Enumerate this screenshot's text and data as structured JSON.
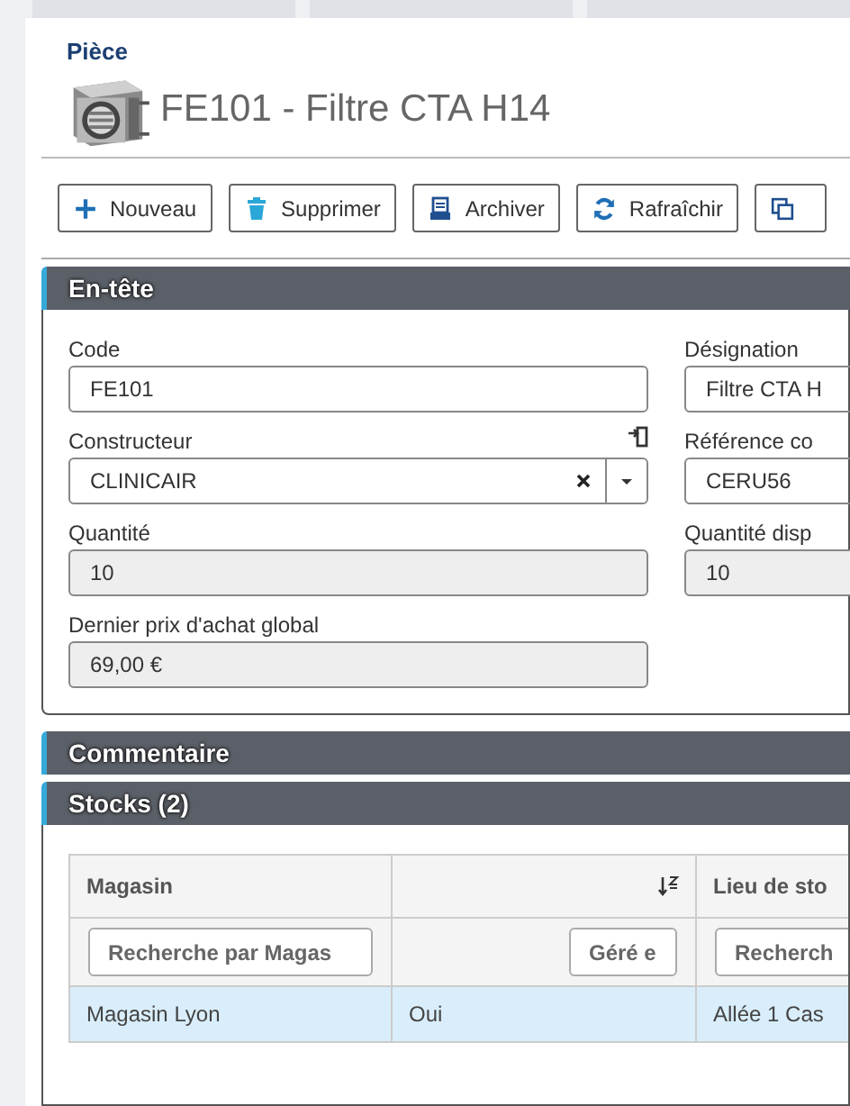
{
  "header": {
    "breadcrumb": "Pièce",
    "title": "FE101 - Filtre CTA H14"
  },
  "toolbar": [
    {
      "kind": "new",
      "label": "Nouveau"
    },
    {
      "kind": "delete",
      "label": "Supprimer"
    },
    {
      "kind": "archive",
      "label": "Archiver"
    },
    {
      "kind": "refresh",
      "label": "Rafraîchir"
    },
    {
      "kind": "copy"
    }
  ],
  "en_tete": {
    "title": "En-tête",
    "rows": [
      {
        "fields": [
          {
            "kind": "text",
            "label": "Code",
            "value": "FE101"
          },
          {
            "kind": "text",
            "label": "Désignation",
            "value": "Filtre CTA H"
          }
        ]
      },
      {
        "fields": [
          {
            "kind": "combo",
            "label": "Constructeur",
            "value": "CLINICAIR"
          },
          {
            "kind": "text",
            "label": "Référence co",
            "value": "CERU56"
          }
        ]
      },
      {
        "fields": [
          {
            "kind": "readonly",
            "label": "Quantité",
            "value": "10"
          },
          {
            "kind": "readonly",
            "label": "Quantité disp",
            "value": "10"
          }
        ]
      },
      {
        "fields": [
          {
            "kind": "readonly",
            "label": "Dernier prix d'achat global",
            "value": "69,00 €"
          }
        ]
      }
    ]
  },
  "commentaire": {
    "title": "Commentaire"
  },
  "stocks": {
    "title": "Stocks (2)",
    "table": {
      "columns": [
        {
          "header": "Magasin",
          "sorted": false,
          "placeholder": "Recherche par Magas"
        },
        {
          "sorted": true,
          "placeholder": "Géré e"
        },
        {
          "header": "Lieu de sto",
          "sorted": false,
          "placeholder": "Recherch"
        }
      ],
      "rows": [
        [
          "Magasin Lyon",
          "Oui",
          "Allée 1 Cas"
        ]
      ]
    }
  }
}
